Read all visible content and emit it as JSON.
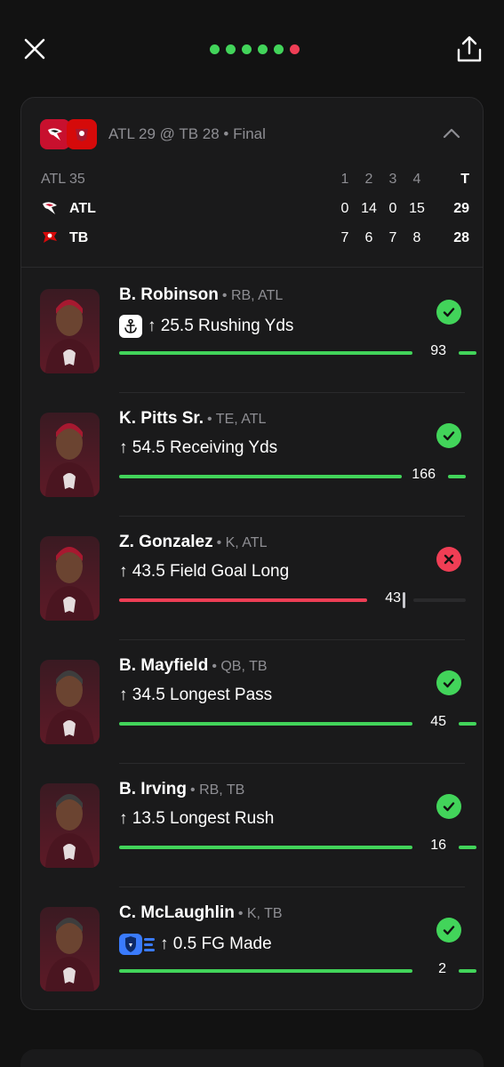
{
  "colors": {
    "green": "#42d45a",
    "red": "#ef3e55",
    "muted": "#8e8e93",
    "atl_red": "#c8102e",
    "tb_red": "#d50a0a"
  },
  "progress_dots": [
    "green",
    "green",
    "green",
    "green",
    "green",
    "red"
  ],
  "game": {
    "status": "ATL 29 @ TB 28 • Final",
    "header_label": "ATL 35",
    "quarter_headers": [
      "1",
      "2",
      "3",
      "4"
    ],
    "total_header": "T",
    "teams": [
      {
        "abbr": "ATL",
        "quarters": [
          "0",
          "14",
          "0",
          "15"
        ],
        "total": "29",
        "logo": "falcons-logo"
      },
      {
        "abbr": "TB",
        "quarters": [
          "7",
          "6",
          "7",
          "8"
        ],
        "total": "28",
        "logo": "buccaneers-logo"
      }
    ]
  },
  "props": [
    {
      "name": "B. Robinson",
      "meta": "• RB, ATL",
      "line": "↑ 25.5 Rushing Yds",
      "badge": "anchor-icon",
      "result": "93",
      "hit": true,
      "progress": 0.85,
      "team": "ATL"
    },
    {
      "name": "K. Pitts Sr.",
      "meta": "• TE, ATL",
      "line": "↑ 54.5 Receiving Yds",
      "badge": null,
      "result": "166",
      "hit": true,
      "progress": 0.82,
      "team": "ATL"
    },
    {
      "name": "Z. Gonzalez",
      "meta": "• K, ATL",
      "line": "↑ 43.5 Field Goal Long",
      "badge": null,
      "result": "43",
      "hit": false,
      "progress": 0.72,
      "team": "ATL"
    },
    {
      "name": "B. Mayfield",
      "meta": "• QB, TB",
      "line": "↑ 34.5 Longest Pass",
      "badge": null,
      "result": "45",
      "hit": true,
      "progress": 0.85,
      "team": "TB"
    },
    {
      "name": "B. Irving",
      "meta": "• RB, TB",
      "line": "↑ 13.5 Longest Rush",
      "badge": null,
      "result": "16",
      "hit": true,
      "progress": 0.85,
      "team": "TB"
    },
    {
      "name": "C. McLaughlin",
      "meta": "• K, TB",
      "line": "↑ 0.5 FG Made",
      "badge": "shield-boost-icon",
      "result": "2",
      "hit": true,
      "progress": 0.85,
      "team": "TB"
    }
  ]
}
